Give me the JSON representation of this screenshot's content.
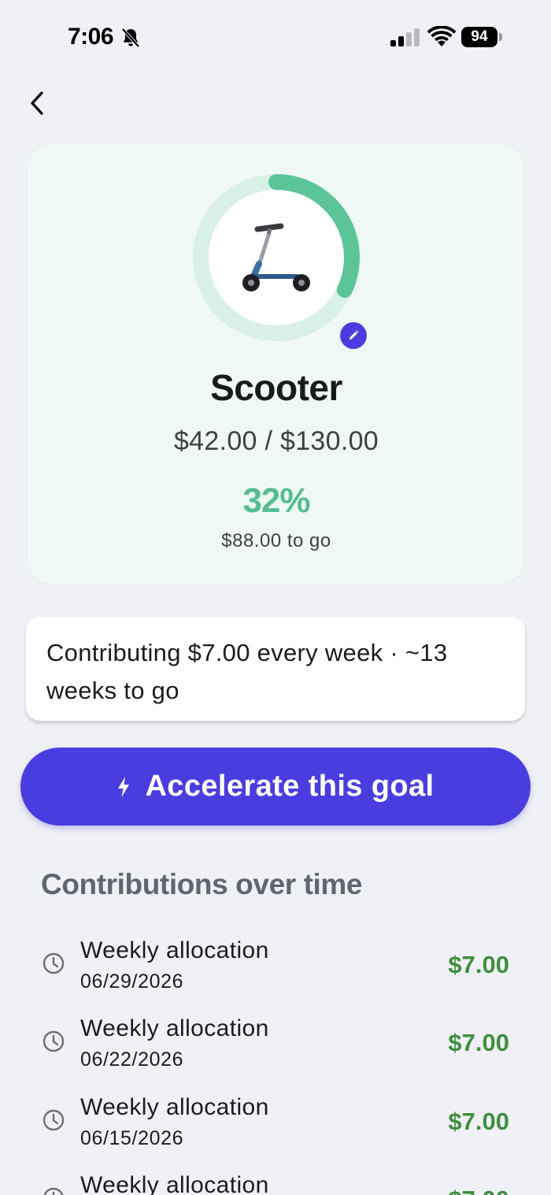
{
  "status_bar": {
    "time": "7:06",
    "battery": "94"
  },
  "goal": {
    "emoji": "🛴",
    "name": "Scooter",
    "amounts": "$42.00 / $130.00",
    "percent_label": "32%",
    "progress": 0.32,
    "remaining": "$88.00 to go"
  },
  "contribution_info": "Contributing $7.00 every week · ~13 weeks to go",
  "accelerate": {
    "label": "Accelerate this goal"
  },
  "contributions": {
    "title": "Contributions over time",
    "items": [
      {
        "title": "Weekly allocation",
        "date": "06/29/2026",
        "amount": "$7.00"
      },
      {
        "title": "Weekly allocation",
        "date": "06/22/2026",
        "amount": "$7.00"
      },
      {
        "title": "Weekly allocation",
        "date": "06/15/2026",
        "amount": "$7.00"
      },
      {
        "title": "Weekly allocation",
        "date": "",
        "amount": "$7.00"
      }
    ]
  },
  "colors": {
    "accent": "#4a3de0",
    "progress": "#5cc597",
    "progress_track": "#d9f0e6",
    "card_bg": "#eff8f5",
    "amount_green": "#3f8f3f"
  }
}
